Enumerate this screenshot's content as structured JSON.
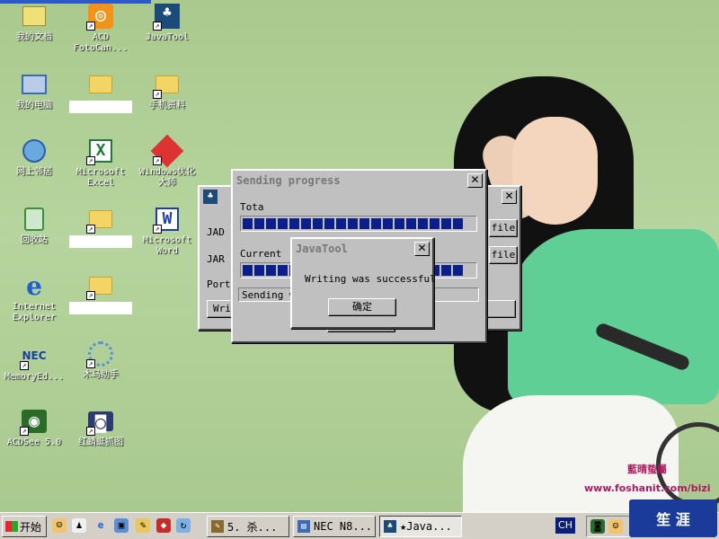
{
  "desktop_icons": [
    {
      "label": "我的文档",
      "icon": "my-documents-icon"
    },
    {
      "label": "我的电脑",
      "icon": "my-computer-icon"
    },
    {
      "label": "网上邻居",
      "icon": "network-places-icon"
    },
    {
      "label": "回收站",
      "icon": "recycle-bin-icon"
    },
    {
      "label": "Internet\nExplorer",
      "icon": "ie-icon"
    },
    {
      "label": "MemoryEd...",
      "icon": "nec-icon"
    },
    {
      "label": "ACDSee 5.0",
      "icon": "acdsee-icon"
    },
    {
      "label": "ACD\nFotoCan...",
      "icon": "acd-fotocanvas-icon"
    },
    {
      "label": "",
      "icon": "folder-icon"
    },
    {
      "label": "Microsoft\nExcel",
      "icon": "excel-icon"
    },
    {
      "label": "",
      "icon": "folder-icon"
    },
    {
      "label": "",
      "icon": "folder-icon"
    },
    {
      "label": "木马助手",
      "icon": "trojan-helper-icon"
    },
    {
      "label": "红蜻蜓抓图",
      "icon": "capture-icon"
    },
    {
      "label": "JavaTool",
      "icon": "javatool-icon"
    },
    {
      "label": "手机资料",
      "icon": "folder-icon"
    },
    {
      "label": "Windows优化\n大师",
      "icon": "windows-optimizer-icon"
    },
    {
      "label": "Microsoft\nWord",
      "icon": "word-icon"
    }
  ],
  "wallpaper_text": {
    "line1": "藍晴蛰屬",
    "line2": "www.foshanit.com/bizi"
  },
  "back_window": {
    "labels": {
      "jad": "JAD",
      "jar": "JAR",
      "port": "PortN"
    },
    "file_button": "file",
    "file_button2": "file",
    "write_button": "Wri",
    "right_button": "T"
  },
  "sending_window": {
    "title": "Sending progress",
    "close": "✕",
    "total_label": "Tota",
    "current_label": "Current",
    "status": "Sending w",
    "total_progress": 1.0,
    "current_progress": 1.0
  },
  "dialog": {
    "title": "JavaTool",
    "close": "✕",
    "message": "Writing was successful",
    "ok_button": "确定"
  },
  "taskbar": {
    "start_label": "开始",
    "tasks": [
      {
        "label": "5. 杀...",
        "active": false
      },
      {
        "label": "NEC N8...",
        "active": false
      },
      {
        "label": "★Java...",
        "active": true
      }
    ],
    "ime": "CH",
    "logo": "笙 涯"
  }
}
